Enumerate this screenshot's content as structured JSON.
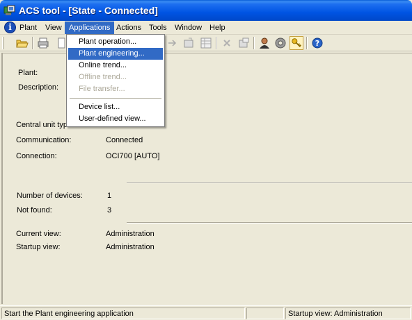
{
  "window": {
    "title": "ACS tool - [State - Connected]",
    "app_icon": "acs-app-icon"
  },
  "menubar": {
    "info_icon": "info-icon",
    "items": [
      "Plant",
      "View",
      "Applications",
      "Actions",
      "Tools",
      "Window",
      "Help"
    ],
    "active": "Applications"
  },
  "toolbar": {
    "icons": [
      "open-folder-icon",
      "print-icon",
      "page-icon",
      "arrow-right-icon",
      "export-icon",
      "table-icon",
      "delete-icon",
      "properties-icon",
      "user-icon",
      "gear-icon",
      "key-icon",
      "help-icon"
    ]
  },
  "applications_menu": {
    "items": [
      {
        "label": "Plant operation...",
        "enabled": true,
        "highlighted": false
      },
      {
        "label": "Plant engineering...",
        "enabled": true,
        "highlighted": true
      },
      {
        "label": "Online trend...",
        "enabled": true,
        "highlighted": false
      },
      {
        "label": "Offline trend...",
        "enabled": false,
        "highlighted": false
      },
      {
        "label": "File transfer...",
        "enabled": false,
        "highlighted": false
      },
      {
        "label": "Device list...",
        "enabled": true,
        "highlighted": false
      },
      {
        "label": "User-defined view...",
        "enabled": true,
        "highlighted": false
      }
    ]
  },
  "state": {
    "plant_label": "Plant:",
    "description_label": "Description:",
    "central_unit_label": "Central unit typ",
    "communication_label": "Communication:",
    "communication_value": "Connected",
    "connection_label": "Connection:",
    "connection_value": "OCI700 [AUTO]",
    "devices_label": "Number of devices:",
    "devices_value": "1",
    "not_found_label": "Not found:",
    "not_found_value": "3",
    "current_view_label": "Current view:",
    "current_view_value": "Administration",
    "startup_view_label": "Startup view:",
    "startup_view_value": "Administration"
  },
  "statusbar": {
    "message": "Start the Plant engineering application",
    "pane2": "",
    "pane3": "Startup view: Administration"
  }
}
